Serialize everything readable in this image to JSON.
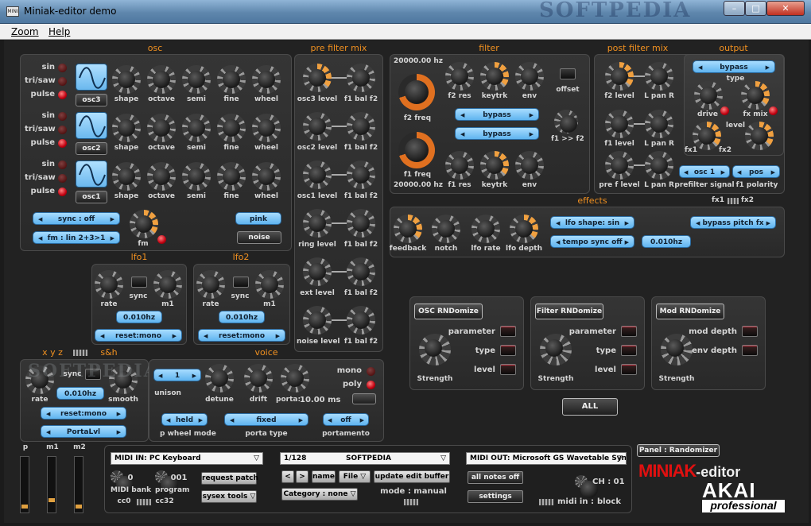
{
  "window": {
    "title": "Miniak-editor demo",
    "icon": "MINI",
    "watermark": "SOFTPEDIA"
  },
  "menu": [
    "Zoom",
    "Help"
  ],
  "osc": {
    "title": "osc",
    "rows": [
      {
        "btn": "osc3",
        "led_labels": [
          "sin",
          "tri/saw",
          "pulse"
        ]
      },
      {
        "btn": "osc2",
        "led_labels": [
          "sin",
          "tri/saw",
          "pulse"
        ]
      },
      {
        "btn": "osc1",
        "led_labels": [
          "sin",
          "tri/saw",
          "pulse"
        ]
      }
    ],
    "knob_labels": [
      "shape",
      "octave",
      "semi",
      "fine",
      "wheel"
    ],
    "sync": "sync : off",
    "fm_mode": "fm : lin 2+3>1",
    "fm_label": "fm",
    "pink": "pink",
    "noise": "noise"
  },
  "prefilter": {
    "title": "pre filter mix",
    "left": [
      "osc3 level",
      "osc2 level",
      "osc1 level",
      "ring level",
      "ext level",
      "noise level"
    ],
    "right": "f1 bal f2"
  },
  "filter": {
    "title": "filter",
    "f2hz": "20000.00 hz",
    "f2freq": "f2 freq",
    "f1freq": "f1 freq",
    "f1hz": "20000.00 hz",
    "top": [
      "f2 res",
      "keytrk",
      "env"
    ],
    "bottom": [
      "f1 res",
      "keytrk",
      "env"
    ],
    "offset": "offset",
    "bypass1": "bypass",
    "bypass2": "bypass",
    "f1f2": "f1 >> f2"
  },
  "postfilter": {
    "title": "post filter mix",
    "rows": [
      [
        "f2 level",
        "L pan R"
      ],
      [
        "f1 level",
        "L pan R"
      ],
      [
        "pre f level",
        "L pan R"
      ]
    ]
  },
  "output": {
    "title": "output",
    "type_sel": "bypass",
    "type": "type",
    "drive": "drive",
    "fxmix": "fx mix",
    "level": "level",
    "fx1": "fx1",
    "fx2": "fx2",
    "prefilter_sel": "osc 1",
    "prefilter_label": "prefilter signal",
    "polarity_sel": "pos",
    "polarity_label": "f1 polarity",
    "fx1b": "fx1",
    "fx2b": "fx2"
  },
  "effects": {
    "title": "effects",
    "knobs": [
      "feedback",
      "notch",
      "lfo rate",
      "lfo depth"
    ],
    "lfo_shape": "lfo shape: sin",
    "tempo_sync": "tempo sync off",
    "rate": "0.010hz",
    "bypass_pitch": "bypass pitch fx"
  },
  "lfo1": {
    "title": "lfo1",
    "rate": "rate",
    "sync": "sync",
    "m1": "m1",
    "freq": "0.010hz",
    "reset": "reset:mono"
  },
  "lfo2": {
    "title": "lfo2",
    "rate": "rate",
    "sync": "sync",
    "m1": "m1",
    "freq": "0.010hz",
    "reset": "reset:mono"
  },
  "sh": {
    "title": "s&h",
    "xyz": "x y z",
    "rate": "rate",
    "smooth": "smooth",
    "sync": "sync",
    "freq": "0.010hz",
    "reset": "reset:mono",
    "porta": "PortaLvl"
  },
  "voice": {
    "title": "voice",
    "unison_val": "1",
    "unison": "unison",
    "detune": "detune",
    "drift": "drift",
    "porta": "porta:",
    "porta_val": "10.00 ms",
    "mono": "mono",
    "poly": "poly",
    "pwheel_val": "held",
    "pwheel": "p wheel mode",
    "porta_type_val": "fixed",
    "porta_type": "porta type",
    "portamento_val": "off",
    "portamento": "portamento"
  },
  "random": [
    {
      "title": "OSC RNDomize",
      "labels": [
        "parameter",
        "type",
        "level"
      ],
      "strength": "Strength"
    },
    {
      "title": "Filter RNDomize",
      "labels": [
        "parameter",
        "type",
        "level"
      ],
      "strength": "Strength"
    },
    {
      "title": "Mod RNDomize",
      "labels": [
        "mod depth",
        "env depth"
      ],
      "strength": "Strength"
    }
  ],
  "all": "ALL",
  "faders": [
    "p",
    "m1",
    "m2"
  ],
  "midi": {
    "in": "MIDI IN: PC Keyboard",
    "bank_val": "0",
    "bank": "MIDI bank",
    "prog_val": "001",
    "prog": "program",
    "cc0": "cc0",
    "cc32": "cc32",
    "request": "request patch",
    "sysex": "sysex tools",
    "patch_num": "1/128",
    "patch_name": "SOFTPEDIA",
    "prev": "<",
    "next": ">",
    "name": "name",
    "file": "File",
    "update": "update edit buffer",
    "category": "Category : none",
    "mode": "mode : manual",
    "out": "MIDI OUT: Microsoft GS Wavetable Syn",
    "notes_off": "all notes off",
    "settings": "settings",
    "ch": "CH : 01",
    "midi_in": "midi in :",
    "block": "block"
  },
  "panel_tab": "Panel : Randomizer",
  "brand": {
    "miniak": "MINIAK",
    "editor": "-editor",
    "akai": "AKAI",
    "professional": "professional"
  },
  "colors": {
    "accent": "#f09020",
    "pill": "#6ab8ee",
    "led": "#e0101a"
  }
}
